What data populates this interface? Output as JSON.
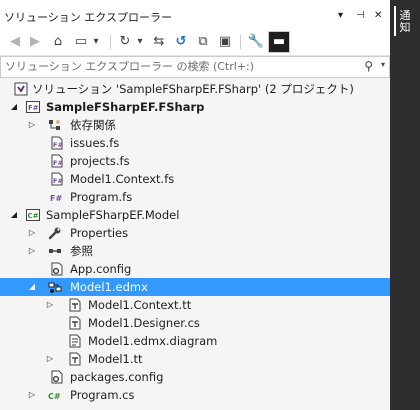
{
  "window": {
    "title": "ソリューション エクスプローラー",
    "pin_glyph": "▾",
    "pin2_glyph": "⊣",
    "close_glyph": "✕"
  },
  "toolbar": {
    "back": "◀",
    "forward": "▶",
    "home": "⌂",
    "switch_views": "▭",
    "dropdown": "▾",
    "pending_changes": "↻",
    "history_dropdown": "▾",
    "sync": "⇆",
    "refresh": "↺",
    "collapse_all": "⧉",
    "show_all_files": "▣",
    "properties": "🔧",
    "preview": "▬"
  },
  "search": {
    "placeholder": "ソリューション エクスプローラー の検索 (Ctrl+:)",
    "value": "",
    "icon": "⚲",
    "dropdown": "▾"
  },
  "tree": [
    {
      "label": "ソリューション 'SampleFSharpEF.FSharp' (2 プロジェクト)",
      "icon": "solution-icon",
      "level": 0,
      "expander": "none",
      "bold": false,
      "selected": false
    },
    {
      "label": "SampleFSharpEF.FSharp",
      "icon": "fsharp-project-icon",
      "level": 0,
      "expander": "expanded",
      "bold": true,
      "selected": false
    },
    {
      "label": "依存関係",
      "icon": "dependencies-icon",
      "level": 1,
      "expander": "collapsed",
      "bold": false,
      "selected": false
    },
    {
      "label": "issues.fs",
      "icon": "fs-file-icon",
      "level": 1,
      "expander": "none",
      "bold": false,
      "selected": false
    },
    {
      "label": "projects.fs",
      "icon": "fs-file-icon",
      "level": 1,
      "expander": "none",
      "bold": false,
      "selected": false
    },
    {
      "label": "Model1.Context.fs",
      "icon": "fs-file-icon",
      "level": 1,
      "expander": "none",
      "bold": false,
      "selected": false
    },
    {
      "label": "Program.fs",
      "icon": "fsharp-file-icon",
      "level": 1,
      "expander": "none",
      "bold": false,
      "selected": false
    },
    {
      "label": "SampleFSharpEF.Model",
      "icon": "csharp-project-icon",
      "level": 0,
      "expander": "expanded",
      "bold": false,
      "selected": false
    },
    {
      "label": "Properties",
      "icon": "wrench-icon",
      "level": 1,
      "expander": "collapsed",
      "bold": false,
      "selected": false
    },
    {
      "label": "参照",
      "icon": "references-icon",
      "level": 1,
      "expander": "collapsed",
      "bold": false,
      "selected": false
    },
    {
      "label": "App.config",
      "icon": "config-file-icon",
      "level": 1,
      "expander": "none",
      "bold": false,
      "selected": false
    },
    {
      "label": "Model1.edmx",
      "icon": "edmx-file-icon",
      "level": 1,
      "expander": "expanded",
      "bold": false,
      "selected": true
    },
    {
      "label": "Model1.Context.tt",
      "icon": "tt-file-icon",
      "level": 2,
      "expander": "collapsed",
      "bold": false,
      "selected": false
    },
    {
      "label": "Model1.Designer.cs",
      "icon": "cs-file-icon",
      "level": 2,
      "expander": "none",
      "bold": false,
      "selected": false
    },
    {
      "label": "Model1.edmx.diagram",
      "icon": "diagram-file-icon",
      "level": 2,
      "expander": "none",
      "bold": false,
      "selected": false
    },
    {
      "label": "Model1.tt",
      "icon": "tt-file-icon",
      "level": 2,
      "expander": "collapsed",
      "bold": false,
      "selected": false
    },
    {
      "label": "packages.config",
      "icon": "config-file-icon",
      "level": 1,
      "expander": "none",
      "bold": false,
      "selected": false
    },
    {
      "label": "Program.cs",
      "icon": "csharp-file-icon",
      "level": 1,
      "expander": "collapsed",
      "bold": false,
      "selected": false
    }
  ],
  "dock": {
    "tab_label": "通知"
  },
  "colors": {
    "selection": "#3399ff",
    "fsharp": "#7b4ba3",
    "csharp": "#388a34",
    "folder": "#dcb67a",
    "dock": "#2d2d30"
  }
}
